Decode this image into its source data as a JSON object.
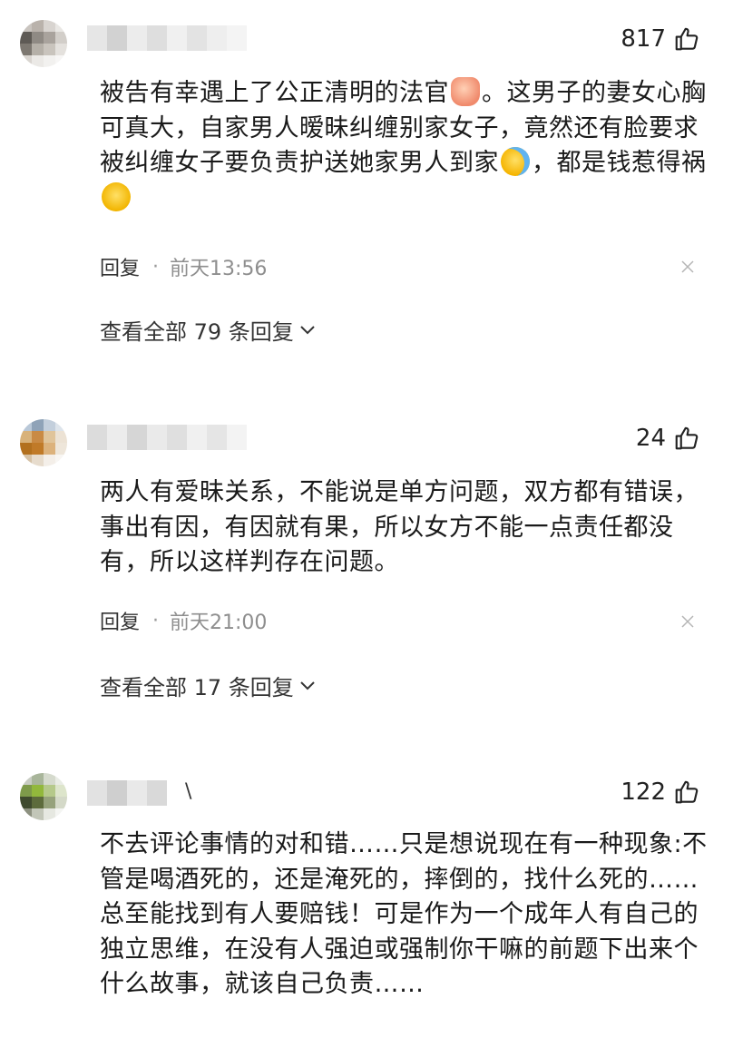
{
  "comments": [
    {
      "likes": "817",
      "text_parts": [
        "被告有幸遇上了公正清明的法官",
        "。这男子的妻女心胸可真大，自家男人暧昧纠缠别家女子，竟然还有脸要求被纠缠女子要负责护送她家男人到家",
        "，都是钱惹得祸"
      ],
      "emojis": [
        "thumbs-up-emoji",
        "laughing-crying-emoji",
        "smirk-emoji"
      ],
      "reply_label": "回复",
      "time": "前天13:56",
      "view_all": "查看全部 79 条回复"
    },
    {
      "likes": "24",
      "text": "两人有爱昧关系，不能说是单方问题，双方都有错误，事出有因，有因就有果，所以女方不能一点责任都没有，所以这样判存在问题。",
      "reply_label": "回复",
      "time": "前天21:00",
      "view_all": "查看全部 17 条回复"
    },
    {
      "likes": "122",
      "name_tail": "\\",
      "text": "不去评论事情的对和错……只是想说现在有一种现象:不管是喝酒死的，还是淹死的，摔倒的，找什么死的……总至能找到有人要赔钱！可是作为一个成年人有自己的独立思维，在没有人强迫或强制你干嘛的前题下出来个什么故事，就该自己负责……"
    }
  ],
  "colors": {
    "text": "#1a1a1a",
    "meta": "#8e8e8e",
    "icon": "#333333"
  }
}
